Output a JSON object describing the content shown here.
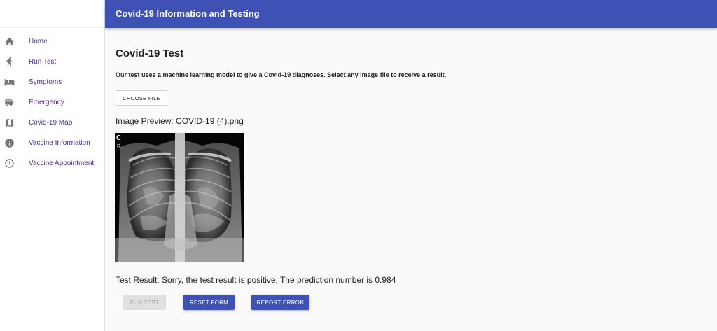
{
  "app": {
    "title": "Covid-19 Information and Testing",
    "accent_color": "#3f51b5",
    "nav_text_color": "#4a2c8f"
  },
  "sidebar": {
    "items": [
      {
        "label": "Home",
        "icon": "home-icon"
      },
      {
        "label": "Run Test",
        "icon": "running-person-icon"
      },
      {
        "label": "Symptoms",
        "icon": "hotel-bed-icon"
      },
      {
        "label": "Emergency",
        "icon": "bus-icon"
      },
      {
        "label": "Covid-19 Map",
        "icon": "map-icon"
      },
      {
        "label": "Vaccine Information",
        "icon": "info-icon"
      },
      {
        "label": "Vaccine Appointment",
        "icon": "clock-icon"
      }
    ]
  },
  "main": {
    "title": "Covid-19 Test",
    "description": "Our test uses a machine learning model to give a Covid-19 diagnoses. Select any image file to receive a result.",
    "choose_file_label": "CHOOSE FILE",
    "preview_title": "Image Preview: COVID-19 (4).png",
    "image_markers": {
      "top": "C",
      "side": "R"
    },
    "result_text": "Test Result: Sorry, the test result is positive. The prediction number is 0.984",
    "buttons": {
      "run_test": "RUN TEST",
      "reset_form": "RESET FORM",
      "report_error": "REPORT ERROR"
    }
  }
}
